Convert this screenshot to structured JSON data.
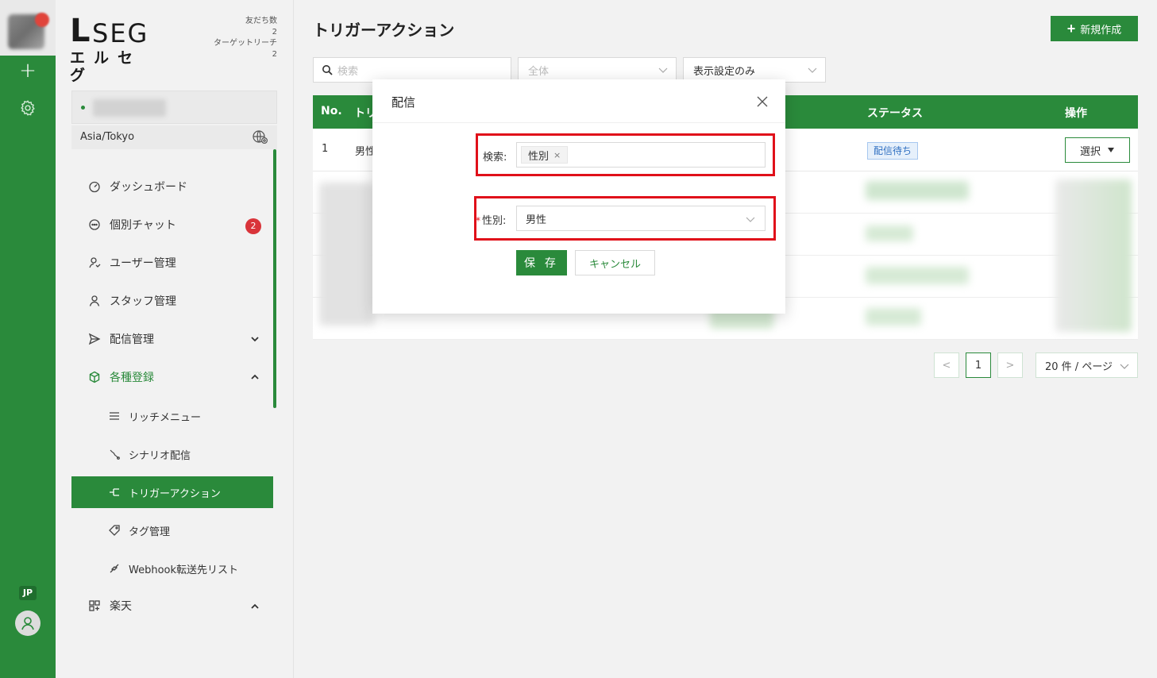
{
  "app": {
    "logo_main": "SEG",
    "logo_l": "L",
    "logo_kana": "エルセグ",
    "stats": [
      {
        "label": "友だち数",
        "value": "2"
      },
      {
        "label": "ターゲットリーチ",
        "value": "2"
      }
    ]
  },
  "rail": {
    "language": "JP"
  },
  "sidebar": {
    "timezone": "Asia/Tokyo",
    "items": [
      {
        "label": "ダッシュボード",
        "icon": "dashboard-icon"
      },
      {
        "label": "個別チャット",
        "icon": "chat-icon",
        "badge": "2"
      },
      {
        "label": "ユーザー管理",
        "icon": "users-icon"
      },
      {
        "label": "スタッフ管理",
        "icon": "person-icon"
      },
      {
        "label": "配信管理",
        "icon": "send-icon",
        "expanded": false
      },
      {
        "label": "各種登録",
        "icon": "cube-icon",
        "expanded": true
      },
      {
        "label": "楽天",
        "icon": "grid-icon",
        "expanded": true
      }
    ],
    "sub_items": [
      {
        "label": "リッチメニュー",
        "icon": "menu-icon"
      },
      {
        "label": "シナリオ配信",
        "icon": "scenario-icon"
      },
      {
        "label": "トリガーアクション",
        "icon": "trigger-icon",
        "active": true
      },
      {
        "label": "タグ管理",
        "icon": "tag-icon"
      },
      {
        "label": "Webhook転送先リスト",
        "icon": "webhook-icon"
      }
    ]
  },
  "main": {
    "title": "トリガーアクション",
    "new_button": "新規作成",
    "search_placeholder": "検索",
    "filter_all": "全体",
    "filter_display": "表示設定のみ",
    "table": {
      "headers": [
        "No.",
        "トリ",
        "ステータス",
        "操作"
      ],
      "rows": [
        {
          "no": "1",
          "name": "男性",
          "status": "配信待ち",
          "action": "選択"
        }
      ]
    },
    "pagination": {
      "prev": "<",
      "current": "1",
      "next": ">",
      "page_size": "20 件 / ページ"
    }
  },
  "modal": {
    "title": "配信",
    "search_label": "検索:",
    "search_chip": "性別",
    "gender_label": "性別:",
    "gender_value": "男性",
    "save": "保 存",
    "cancel": "キャンセル"
  },
  "colors": {
    "brand_green": "#2a8a3b",
    "highlight_red": "#e0101a",
    "badge_red": "#d9343a",
    "status_blue": "#2f6fc1"
  }
}
